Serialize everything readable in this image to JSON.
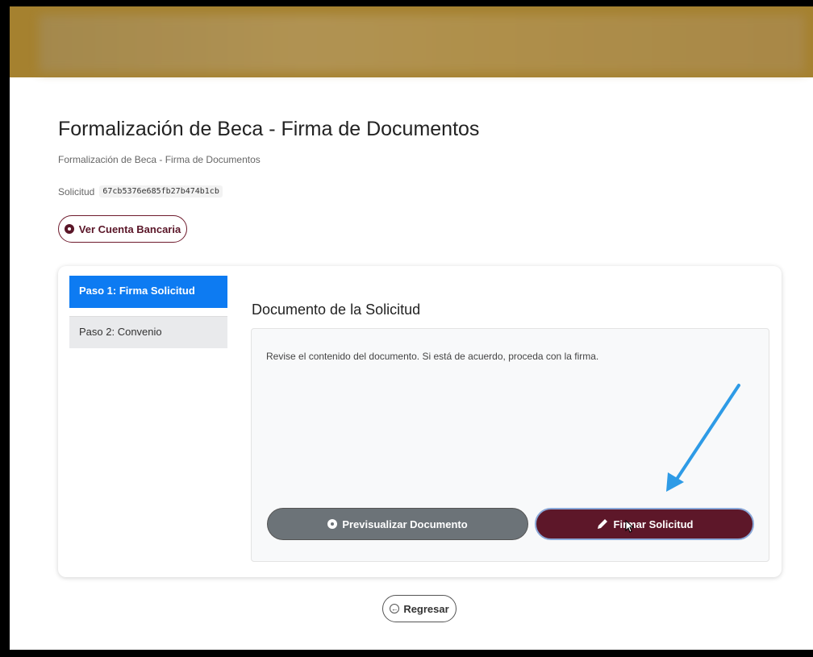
{
  "header": {
    "brand_color": "#a5812f"
  },
  "page": {
    "title": "Formalización de Beca - Firma de Documentos",
    "subtitle": "Formalización de Beca - Firma de Documentos",
    "solicitud_label": "Solicitud",
    "solicitud_id": "67cb5376e685fb27b474b1cb"
  },
  "actions": {
    "ver_cuenta_label": "Ver Cuenta Bancaria",
    "regresar_label": "Regresar"
  },
  "steps": [
    {
      "label": "Paso 1: Firma Solicitud",
      "active": true
    },
    {
      "label": "Paso 2: Convenio",
      "active": false
    }
  ],
  "document": {
    "title": "Documento de la Solicitud",
    "instructions": "Revise el contenido del documento. Si está de acuerdo, proceda con la firma.",
    "preview_label": "Previsualizar Documento",
    "sign_label": "Firmar Solicitud"
  },
  "colors": {
    "accent": "#5d1729",
    "step_active": "#0d7bf2",
    "annotation_arrow": "#2e9be6"
  },
  "icons": [
    "eye-icon",
    "pen-icon",
    "back-arrow-icon",
    "cursor-icon",
    "annotation-arrow"
  ]
}
